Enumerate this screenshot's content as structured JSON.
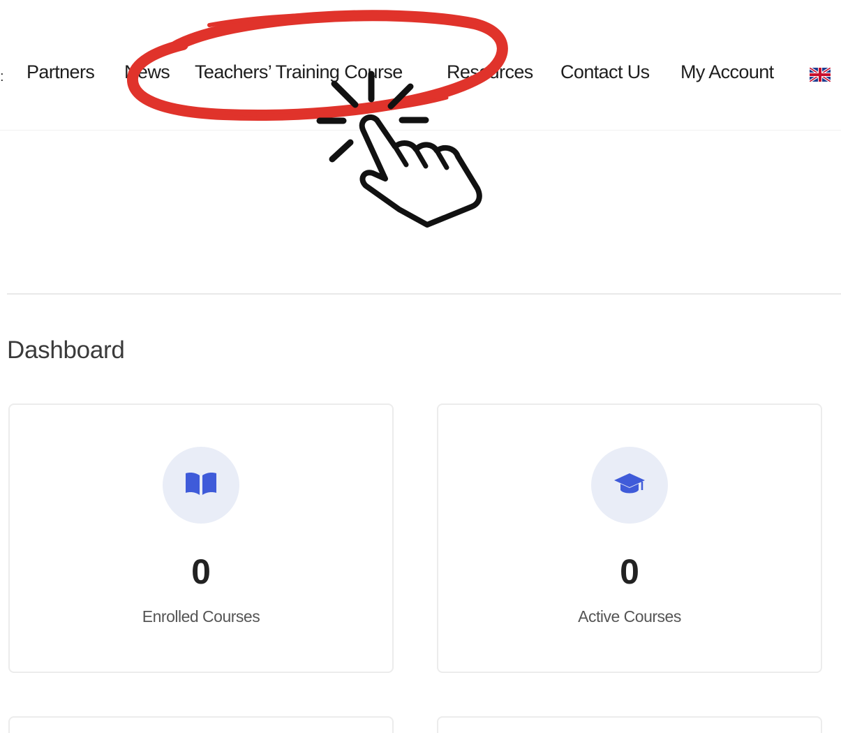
{
  "nav": {
    "items": [
      {
        "label": "Partners"
      },
      {
        "label": "News"
      },
      {
        "label": "Teachers’ Training Course"
      },
      {
        "label": "Resources"
      },
      {
        "label": "Contact Us"
      },
      {
        "label": "My Account"
      }
    ],
    "flag_icon": "uk-flag-icon"
  },
  "dashboard": {
    "title": "Dashboard",
    "cards": [
      {
        "value": "0",
        "label": "Enrolled Courses",
        "icon": "open-book-icon"
      },
      {
        "value": "0",
        "label": "Active Courses",
        "icon": "graduation-cap-icon"
      }
    ]
  },
  "colors": {
    "accent": "#3f5bd9",
    "icon_bg": "#e9edf7",
    "annotation_red": "#e0332b"
  },
  "annotation": {
    "highlighted_item": "Teachers’ Training Course",
    "pointer_icon": "hand-pointer-icon"
  }
}
